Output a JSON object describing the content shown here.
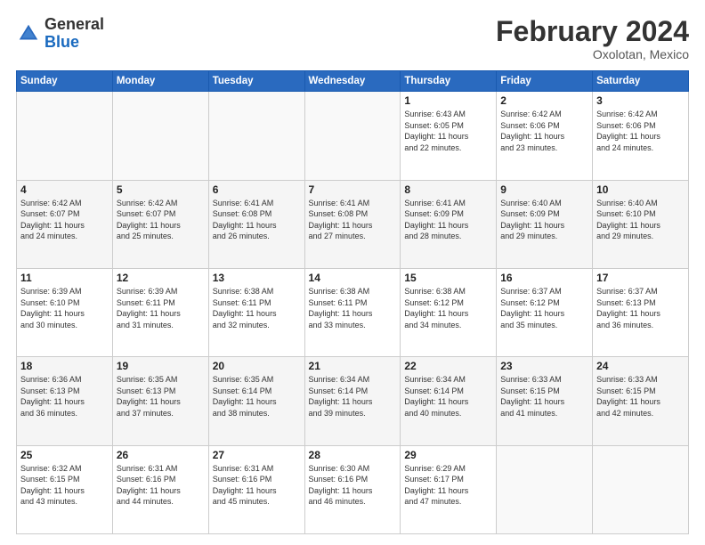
{
  "header": {
    "logo_general": "General",
    "logo_blue": "Blue",
    "month_title": "February 2024",
    "location": "Oxolotan, Mexico"
  },
  "weekdays": [
    "Sunday",
    "Monday",
    "Tuesday",
    "Wednesday",
    "Thursday",
    "Friday",
    "Saturday"
  ],
  "weeks": [
    [
      {
        "day": "",
        "text": ""
      },
      {
        "day": "",
        "text": ""
      },
      {
        "day": "",
        "text": ""
      },
      {
        "day": "",
        "text": ""
      },
      {
        "day": "1",
        "text": "Sunrise: 6:43 AM\nSunset: 6:05 PM\nDaylight: 11 hours\nand 22 minutes."
      },
      {
        "day": "2",
        "text": "Sunrise: 6:42 AM\nSunset: 6:06 PM\nDaylight: 11 hours\nand 23 minutes."
      },
      {
        "day": "3",
        "text": "Sunrise: 6:42 AM\nSunset: 6:06 PM\nDaylight: 11 hours\nand 24 minutes."
      }
    ],
    [
      {
        "day": "4",
        "text": "Sunrise: 6:42 AM\nSunset: 6:07 PM\nDaylight: 11 hours\nand 24 minutes."
      },
      {
        "day": "5",
        "text": "Sunrise: 6:42 AM\nSunset: 6:07 PM\nDaylight: 11 hours\nand 25 minutes."
      },
      {
        "day": "6",
        "text": "Sunrise: 6:41 AM\nSunset: 6:08 PM\nDaylight: 11 hours\nand 26 minutes."
      },
      {
        "day": "7",
        "text": "Sunrise: 6:41 AM\nSunset: 6:08 PM\nDaylight: 11 hours\nand 27 minutes."
      },
      {
        "day": "8",
        "text": "Sunrise: 6:41 AM\nSunset: 6:09 PM\nDaylight: 11 hours\nand 28 minutes."
      },
      {
        "day": "9",
        "text": "Sunrise: 6:40 AM\nSunset: 6:09 PM\nDaylight: 11 hours\nand 29 minutes."
      },
      {
        "day": "10",
        "text": "Sunrise: 6:40 AM\nSunset: 6:10 PM\nDaylight: 11 hours\nand 29 minutes."
      }
    ],
    [
      {
        "day": "11",
        "text": "Sunrise: 6:39 AM\nSunset: 6:10 PM\nDaylight: 11 hours\nand 30 minutes."
      },
      {
        "day": "12",
        "text": "Sunrise: 6:39 AM\nSunset: 6:11 PM\nDaylight: 11 hours\nand 31 minutes."
      },
      {
        "day": "13",
        "text": "Sunrise: 6:38 AM\nSunset: 6:11 PM\nDaylight: 11 hours\nand 32 minutes."
      },
      {
        "day": "14",
        "text": "Sunrise: 6:38 AM\nSunset: 6:11 PM\nDaylight: 11 hours\nand 33 minutes."
      },
      {
        "day": "15",
        "text": "Sunrise: 6:38 AM\nSunset: 6:12 PM\nDaylight: 11 hours\nand 34 minutes."
      },
      {
        "day": "16",
        "text": "Sunrise: 6:37 AM\nSunset: 6:12 PM\nDaylight: 11 hours\nand 35 minutes."
      },
      {
        "day": "17",
        "text": "Sunrise: 6:37 AM\nSunset: 6:13 PM\nDaylight: 11 hours\nand 36 minutes."
      }
    ],
    [
      {
        "day": "18",
        "text": "Sunrise: 6:36 AM\nSunset: 6:13 PM\nDaylight: 11 hours\nand 36 minutes."
      },
      {
        "day": "19",
        "text": "Sunrise: 6:35 AM\nSunset: 6:13 PM\nDaylight: 11 hours\nand 37 minutes."
      },
      {
        "day": "20",
        "text": "Sunrise: 6:35 AM\nSunset: 6:14 PM\nDaylight: 11 hours\nand 38 minutes."
      },
      {
        "day": "21",
        "text": "Sunrise: 6:34 AM\nSunset: 6:14 PM\nDaylight: 11 hours\nand 39 minutes."
      },
      {
        "day": "22",
        "text": "Sunrise: 6:34 AM\nSunset: 6:14 PM\nDaylight: 11 hours\nand 40 minutes."
      },
      {
        "day": "23",
        "text": "Sunrise: 6:33 AM\nSunset: 6:15 PM\nDaylight: 11 hours\nand 41 minutes."
      },
      {
        "day": "24",
        "text": "Sunrise: 6:33 AM\nSunset: 6:15 PM\nDaylight: 11 hours\nand 42 minutes."
      }
    ],
    [
      {
        "day": "25",
        "text": "Sunrise: 6:32 AM\nSunset: 6:15 PM\nDaylight: 11 hours\nand 43 minutes."
      },
      {
        "day": "26",
        "text": "Sunrise: 6:31 AM\nSunset: 6:16 PM\nDaylight: 11 hours\nand 44 minutes."
      },
      {
        "day": "27",
        "text": "Sunrise: 6:31 AM\nSunset: 6:16 PM\nDaylight: 11 hours\nand 45 minutes."
      },
      {
        "day": "28",
        "text": "Sunrise: 6:30 AM\nSunset: 6:16 PM\nDaylight: 11 hours\nand 46 minutes."
      },
      {
        "day": "29",
        "text": "Sunrise: 6:29 AM\nSunset: 6:17 PM\nDaylight: 11 hours\nand 47 minutes."
      },
      {
        "day": "",
        "text": ""
      },
      {
        "day": "",
        "text": ""
      }
    ]
  ]
}
